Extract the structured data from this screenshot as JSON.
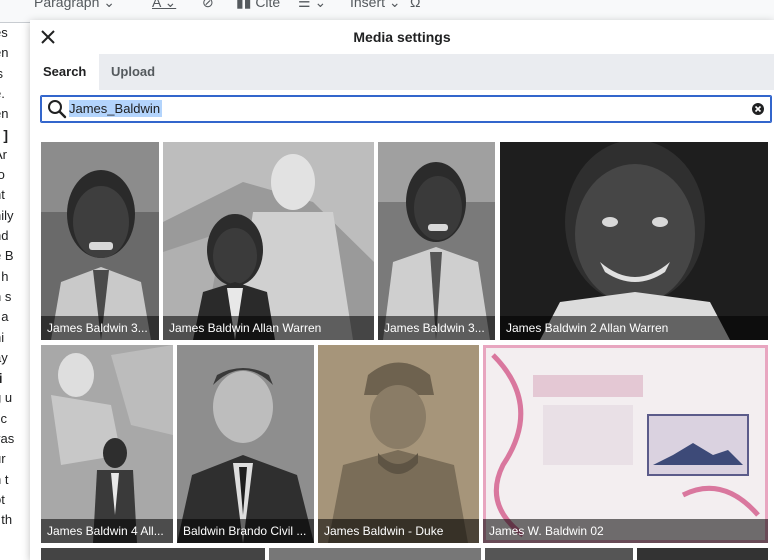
{
  "editor_toolbar": {
    "items": [
      "Paragraph",
      "A",
      "Cite",
      "Insert"
    ]
  },
  "background_text": {
    "lines": [
      "es",
      "en",
      "'s",
      "e.",
      "en",
      "r ]",
      "Ar",
      "to",
      "ht",
      "nily",
      "nd",
      "e B",
      ", h",
      "n s",
      ", a",
      "hi",
      "ay",
      "ti",
      "g u",
      "l c",
      "vas",
      "ur",
      "n t",
      "ot",
      "t th"
    ]
  },
  "dialog": {
    "title": "Media settings",
    "tabs": [
      {
        "label": "Search",
        "active": true
      },
      {
        "label": "Upload",
        "active": false
      }
    ],
    "search": {
      "value": "James_Baldwin",
      "placeholder": ""
    },
    "results": [
      {
        "caption": "James Baldwin 3..."
      },
      {
        "caption": "James Baldwin Allan Warren"
      },
      {
        "caption": "James Baldwin 3..."
      },
      {
        "caption": "James Baldwin 2 Allan Warren"
      },
      {
        "caption": "James Baldwin 4 All..."
      },
      {
        "caption": "Baldwin Brando Civil ..."
      },
      {
        "caption": "James Baldwin - Duke"
      },
      {
        "caption": "James W. Baldwin 02"
      }
    ]
  },
  "colors": {
    "accent": "#3366cc",
    "tabs_bg": "#eaecf0",
    "highlight": "#b3d4fc"
  }
}
